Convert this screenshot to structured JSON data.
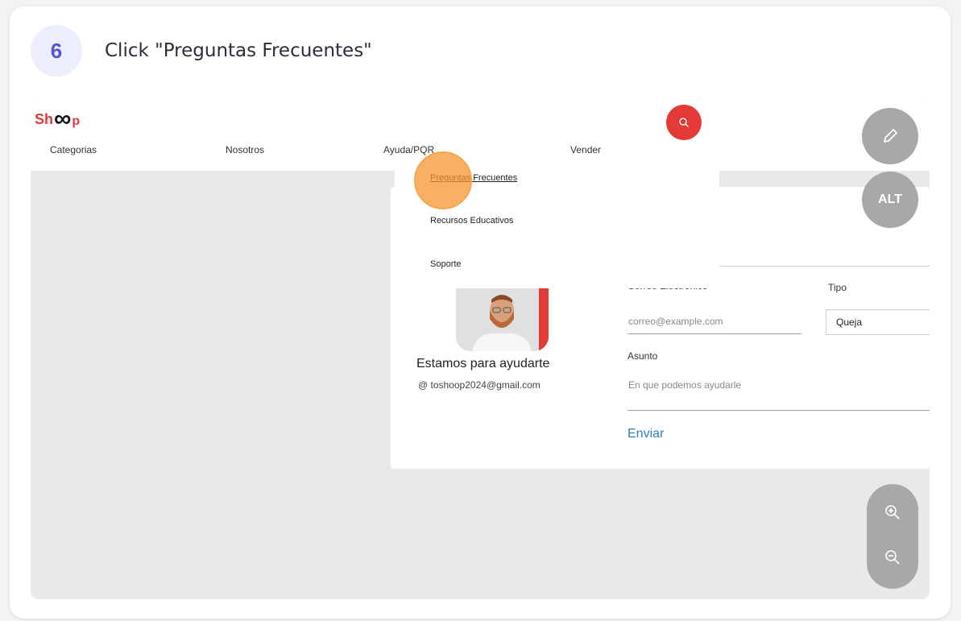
{
  "step": {
    "number": "6",
    "title": "Click \"Preguntas Frecuentes\""
  },
  "site": {
    "logo": {
      "left": "Sh",
      "mark": "∞",
      "right": "p"
    },
    "nav": [
      "Categorias",
      "Nosotros",
      "Ayuda/PQR",
      "Vender"
    ],
    "dropdown": [
      "Preguntas Frecuentes",
      "Recursos Educativos",
      "Soporte"
    ]
  },
  "contact": {
    "heading": "Estamos para ayudarte",
    "email_icon": "@",
    "email": "toshoop2024@gmail.com"
  },
  "form": {
    "email_label": "Correo Electronico",
    "email_placeholder": "correo@example.com",
    "type_label": "Tipo",
    "type_value": "Queja",
    "subject_label": "Asunto",
    "subject_placeholder": "En que podemos ayudarle",
    "submit": "Enviar"
  },
  "tools": {
    "alt": "ALT",
    "edit_icon": "pencil-icon",
    "zoom_in_icon": "zoom-in-icon",
    "zoom_out_icon": "zoom-out-icon"
  },
  "colors": {
    "brand_red": "#e53935",
    "highlight": "#f5962f",
    "step_accent": "#4d58d6",
    "link_blue": "#2f7fc1"
  }
}
